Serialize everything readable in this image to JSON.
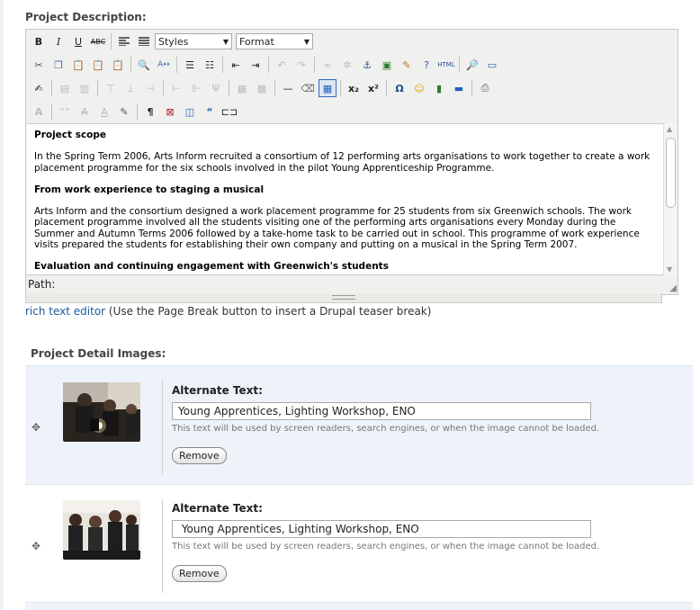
{
  "project_description": {
    "label": "Project Description:",
    "toolbar": {
      "styles_select": "Styles",
      "format_select": "Format"
    },
    "content": {
      "heading1": "Project scope",
      "para1": "In the Spring Term 2006, Arts Inform recruited a consortium of 12 performing arts organisations to work together to create a work placement programme for the six schools involved in the pilot Young Apprenticeship Programme.",
      "heading2": "From work experience to staging a musical",
      "para2": "Arts Inform and the consortium designed a work placement programme for 25 students from six Greenwich schools. The work placement programme involved all the students visiting one of the performing arts organisations every Monday during the Summer and Autumn Terms 2006 followed by a take-home task to be carried out in school. This programme of work experience visits prepared the students for establishing their own company and putting on a musical in the Spring Term 2007.",
      "heading3": "Evaluation and continuing engagement with Greenwich's students"
    },
    "path_label": "Path:",
    "rte_link": "rich text editor",
    "rte_note": " (Use the Page Break button to insert a Drupal teaser break)"
  },
  "project_images": {
    "label": "Project Detail Images:",
    "items": [
      {
        "alt_label": "Alternate Text:",
        "alt_value": "Young Apprentices, Lighting Workshop, ENO",
        "hint": "This text will be used by screen readers, search engines, or when the image cannot be loaded.",
        "remove_label": "Remove"
      },
      {
        "alt_label": "Alternate Text:",
        "alt_value": " Young Apprentices, Lighting Workshop, ENO",
        "hint": "This text will be used by screen readers, search engines, or when the image cannot be loaded.",
        "remove_label": "Remove"
      }
    ]
  }
}
